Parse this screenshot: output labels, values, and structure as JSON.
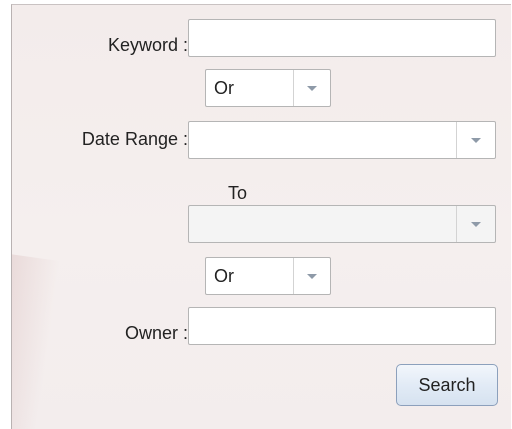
{
  "form": {
    "keyword_label": "Keyword :",
    "keyword_value": "",
    "operator1": "Or",
    "date_range_label": "Date Range :",
    "date_from_value": "",
    "to_label": "To",
    "date_to_value": "",
    "operator2": "Or",
    "owner_label": "Owner :",
    "owner_value": "",
    "search_label": "Search"
  }
}
